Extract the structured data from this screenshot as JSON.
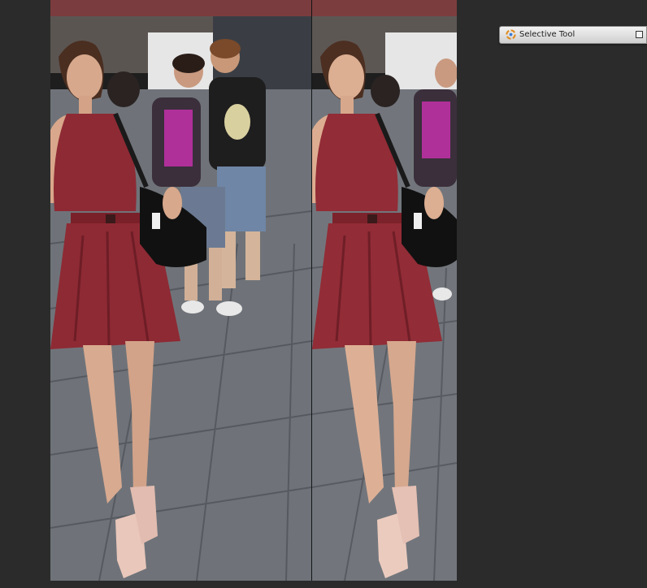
{
  "panel": {
    "title": "Selective Tool",
    "icon": "selective-tool-icon",
    "close_icon": "close-box-icon"
  },
  "canvas": {
    "view_mode": "split-before-after",
    "colors": {
      "background": "#2b2b2b",
      "dress": "#8e2a34",
      "pavement": "#6f7379"
    }
  }
}
